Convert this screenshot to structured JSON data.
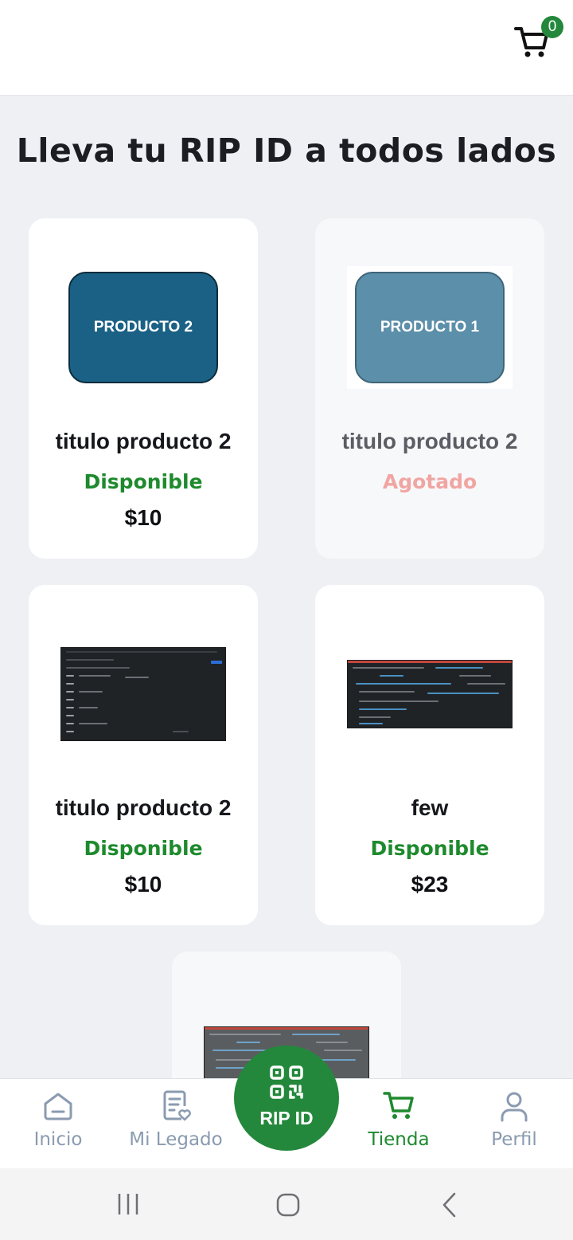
{
  "header": {
    "cart_count": "0"
  },
  "page_title": "Lleva tu RIP ID a todos lados",
  "products": [
    {
      "image_label": "PRODUCTO 2",
      "title": "titulo  producto 2",
      "status": "Disponible",
      "price": "$10"
    },
    {
      "image_label": "PRODUCTO 1",
      "title": "titulo  producto 2",
      "status": "Agotado",
      "price": ""
    },
    {
      "image_label": "",
      "title": "titulo  producto 2",
      "status": "Disponible",
      "price": "$10"
    },
    {
      "image_label": "",
      "title": "few",
      "status": "Disponible",
      "price": "$23"
    }
  ],
  "bottom_nav": {
    "inicio": "Inicio",
    "mi_legado": "Mi Legado",
    "rip_id": "RIP ID",
    "tienda": "Tienda",
    "perfil": "Perfil"
  },
  "colors": {
    "accent_green": "#23883b",
    "available_text": "#1e8a2d",
    "soldout_text": "#f1a5a2",
    "inactive_nav": "#8a9bb0"
  },
  "icons": [
    "cart-icon",
    "home-icon",
    "document-heart-icon",
    "qr-code-icon",
    "user-icon"
  ]
}
